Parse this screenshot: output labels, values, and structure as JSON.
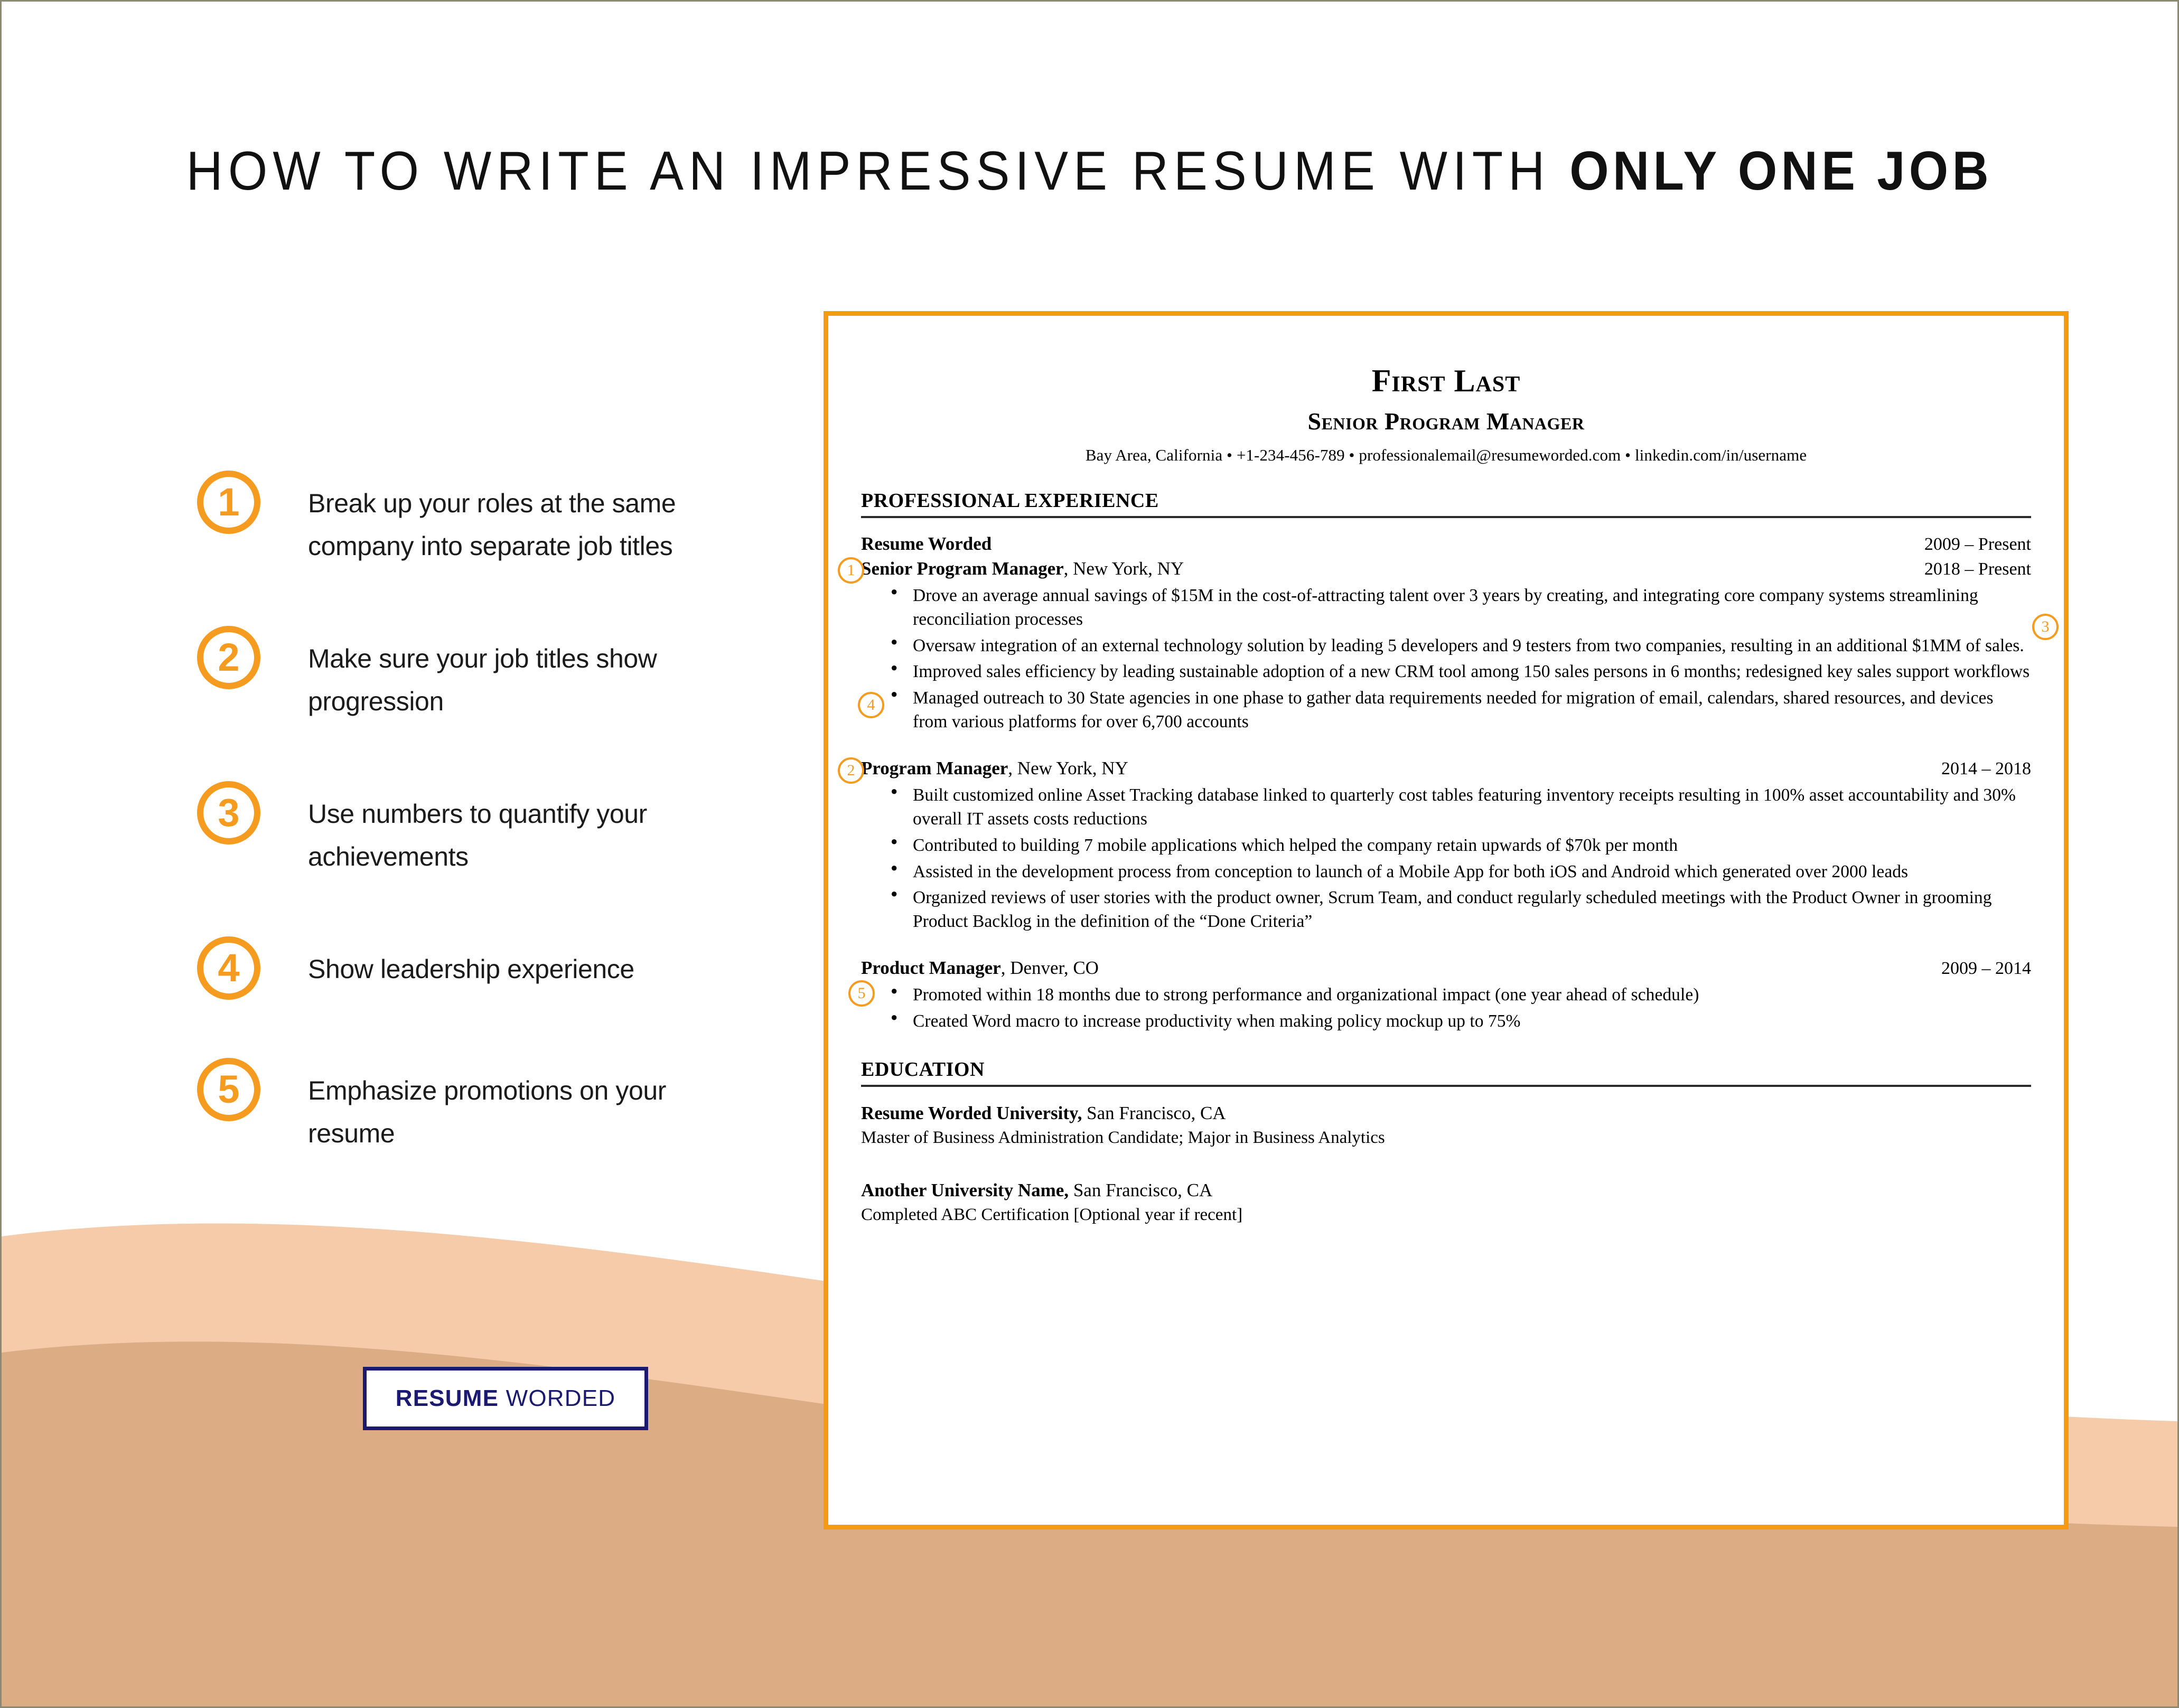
{
  "page": {
    "title_regular": "HOW TO WRITE AN IMPRESSIVE RESUME WITH ",
    "title_bold": "ONLY ONE JOB",
    "colors": {
      "accent_orange": "#F59B1F",
      "card_border_orange": "#F59A12",
      "logo_navy": "#1B1A70",
      "wave_light": "#F5CBAA",
      "wave_dark": "#DCAC85"
    }
  },
  "tips": [
    {
      "number": "1",
      "text": "Break up your roles at the same company into separate job titles"
    },
    {
      "number": "2",
      "text": "Make sure your job titles show progression"
    },
    {
      "number": "3",
      "text": "Use numbers to quantify your achievements"
    },
    {
      "number": "4",
      "text": "Show leadership experience"
    },
    {
      "number": "5",
      "text": "Emphasize promotions on your resume"
    }
  ],
  "logo": {
    "bold": "RESUME",
    "regular": "WORDED"
  },
  "resume": {
    "name": "First Last",
    "role": "Senior Program Manager",
    "contact": "Bay Area, California • +1-234-456-789 • professionalemail@resumeworded.com • linkedin.com/in/username",
    "sections": {
      "experience_heading": "PROFESSIONAL EXPERIENCE",
      "education_heading": "EDUCATION"
    },
    "company": {
      "name": "Resume Worded",
      "dates": "2009 – Present"
    },
    "jobs": [
      {
        "title": "Senior Program Manager",
        "location": ", New York, NY",
        "dates": "2018 – Present",
        "callout": "1",
        "bullets": [
          "Drove an average annual savings of $15M in the cost-of-attracting talent over 3 years by creating, and integrating core company systems streamlining reconciliation processes",
          "Oversaw integration of an external technology solution by leading 5 developers and 9 testers from two companies, resulting in an additional $1MM of sales.",
          "Improved sales efficiency by leading sustainable adoption of a new CRM tool among 150 sales persons in 6 months; redesigned key sales support workflows",
          "Managed outreach to 30 State agencies in one phase to gather data requirements needed for migration of email, calendars, shared resources, and devices from various platforms for over 6,700 accounts"
        ]
      },
      {
        "title": "Program Manager",
        "location": ", New York, NY",
        "dates": "2014 – 2018",
        "callout": "2",
        "bullets": [
          "Built customized online Asset Tracking database linked to quarterly cost tables featuring inventory receipts resulting in 100% asset accountability and 30% overall IT assets costs reductions",
          "Contributed to building 7 mobile applications which helped the company retain upwards of $70k per month",
          "Assisted in the development process from conception to launch of a Mobile App for both iOS and Android which generated over 2000 leads",
          "Organized reviews of user stories with the product owner, Scrum Team, and conduct regularly scheduled meetings with the Product Owner in grooming Product Backlog in the definition of the “Done Criteria”"
        ]
      },
      {
        "title": "Product Manager",
        "location": ", Denver, CO",
        "dates": "2009 – 2014",
        "callout": "",
        "bullets": [
          "Promoted within 18 months due to strong performance and organizational impact (one year ahead of schedule)",
          "Created Word macro to increase productivity when making policy mockup up to 75%"
        ]
      }
    ],
    "inline_callouts": {
      "three": "3",
      "four": "4",
      "five": "5"
    },
    "education": [
      {
        "org_bold": "Resume Worded University,",
        "org_rest": " San Francisco, CA",
        "detail": "Master of Business Administration Candidate; Major in Business Analytics"
      },
      {
        "org_bold": "Another University Name,",
        "org_rest": " San Francisco, CA",
        "detail": "Completed ABC Certification [Optional year if recent]"
      }
    ]
  }
}
